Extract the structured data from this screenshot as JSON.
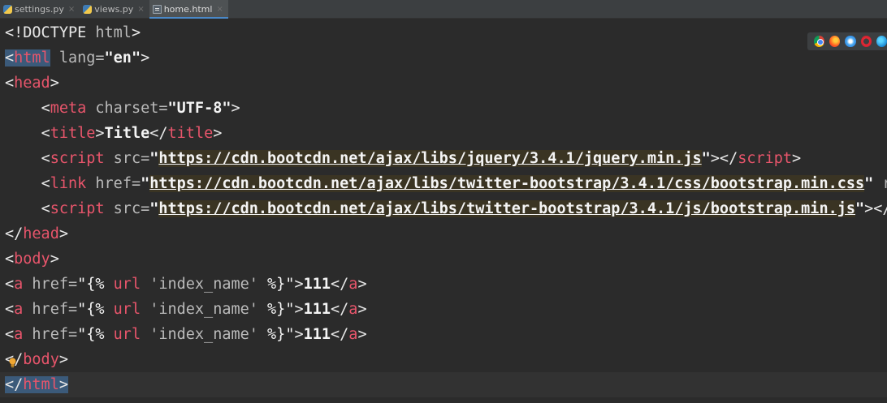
{
  "tabs": [
    {
      "label": "settings.py",
      "icon": "python-file-icon",
      "active": false
    },
    {
      "label": "views.py",
      "icon": "python-file-icon",
      "active": false
    },
    {
      "label": "home.html",
      "icon": "html-file-icon",
      "active": true
    }
  ],
  "tab_close_glyph": "×",
  "browsers": [
    "chrome-icon",
    "firefox-icon",
    "safari-icon",
    "opera-icon",
    "edge-icon"
  ],
  "code": {
    "l1": {
      "a": "<!DOCTYPE ",
      "b": "html",
      "c": ">"
    },
    "l2": {
      "open": "<",
      "tag": "html",
      "attr": " lang=",
      "val": "\"en\"",
      "close": ">"
    },
    "l3": {
      "open": "<",
      "tag": "head",
      "close": ">"
    },
    "l4": {
      "indent": "    ",
      "open": "<",
      "tag": "meta",
      "attr": " charset=",
      "val": "\"UTF-8\"",
      "close": ">"
    },
    "l5": {
      "indent": "    ",
      "open": "<",
      "tag": "title",
      "mid1": ">",
      "text": "Title",
      "mid2": "</",
      "tag2": "title",
      "close": ">"
    },
    "l6": {
      "indent": "    ",
      "open": "<",
      "tag": "script",
      "attr": " src=",
      "q1": "\"",
      "url": "https://cdn.bootcdn.net/ajax/libs/jquery/3.4.1/jquery.min.js",
      "q2": "\"",
      "mid": "></",
      "tag2": "script",
      "close": ">"
    },
    "l7": {
      "indent": "    ",
      "open": "<",
      "tag": "link",
      "attr": " href=",
      "q1": "\"",
      "url": "https://cdn.bootcdn.net/ajax/libs/twitter-bootstrap/3.4.1/css/bootstrap.min.css",
      "q2": "\"",
      "rest": " r"
    },
    "l8": {
      "indent": "    ",
      "open": "<",
      "tag": "script",
      "attr": " src=",
      "q1": "\"",
      "url": "https://cdn.bootcdn.net/ajax/libs/twitter-bootstrap/3.4.1/js/bootstrap.min.js",
      "q2": "\"",
      "rest": "></"
    },
    "l9": {
      "open": "</",
      "tag": "head",
      "close": ">"
    },
    "l10": {
      "open": "<",
      "tag": "body",
      "close": ">"
    },
    "link_line": {
      "open": "<",
      "tag": "a",
      "attr": " href=",
      "q1": "\"",
      "tb1": "{% ",
      "tk": "url",
      "ts": " 'index_name' ",
      "tb2": "%}",
      "q2": "\"",
      "mid1": ">",
      "text": "111",
      "mid2": "</",
      "tag2": "a",
      "close": ">"
    },
    "l14": {
      "open": "</",
      "tag": "body",
      "close": ">"
    },
    "l15": {
      "open": "</",
      "tag": "html",
      "close": ">"
    }
  }
}
